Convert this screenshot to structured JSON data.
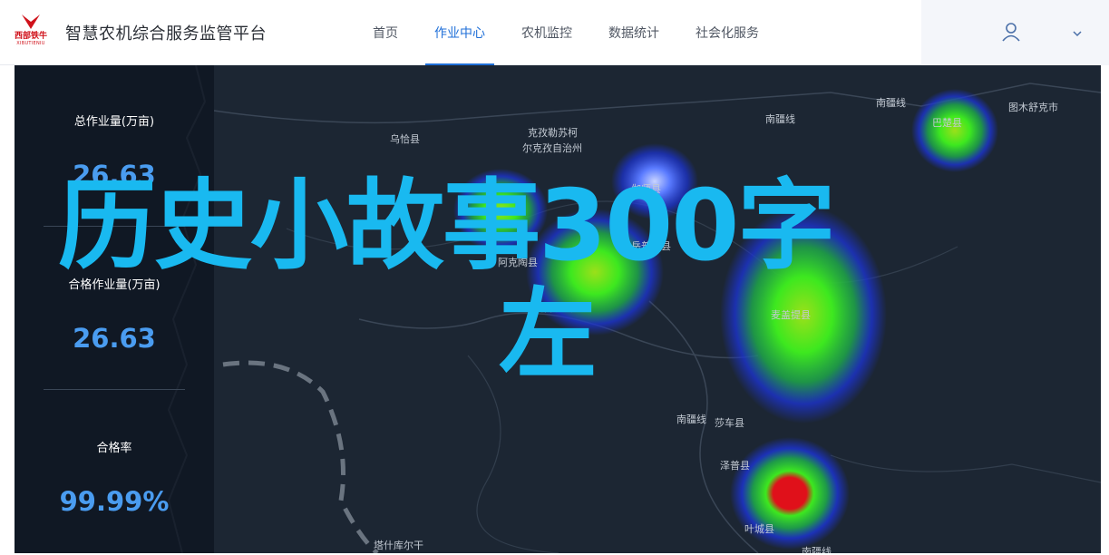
{
  "brand": {
    "logo_main": "西部铁牛",
    "logo_sub": "XIBUTIENIU",
    "title": "智慧农机综合服务监管平台",
    "logo_color": "#d0121b"
  },
  "nav": {
    "items": [
      "首页",
      "作业中心",
      "农机监控",
      "数据统计",
      "社会化服务"
    ],
    "active": "作业中心",
    "active_color": "#1f6fd8"
  },
  "user": {
    "avatar_icon": "user-icon",
    "dropdown_icon": "chevron-down-icon"
  },
  "stats": [
    {
      "label": "总作业量(万亩)",
      "value": "26.63"
    },
    {
      "label": "合格作业量(万亩)",
      "value": "26.63"
    },
    {
      "label": "合格率",
      "value": "99.99%"
    }
  ],
  "map": {
    "places": [
      "乌恰县",
      "克孜勒苏柯",
      "尔克孜自治州",
      "伽师县",
      "南疆线",
      "南疆线",
      "图木舒克市",
      "巴楚县",
      "阿克陶县",
      "岳普湖县",
      "英吉沙县",
      "麦盖提县",
      "南疆线",
      "莎车县",
      "泽普县",
      "叶城县",
      "塔什库尔干",
      "南疆线"
    ]
  },
  "overlay": {
    "line1": "历史小故事300字",
    "line2": "左",
    "color": "#19b9f0"
  }
}
